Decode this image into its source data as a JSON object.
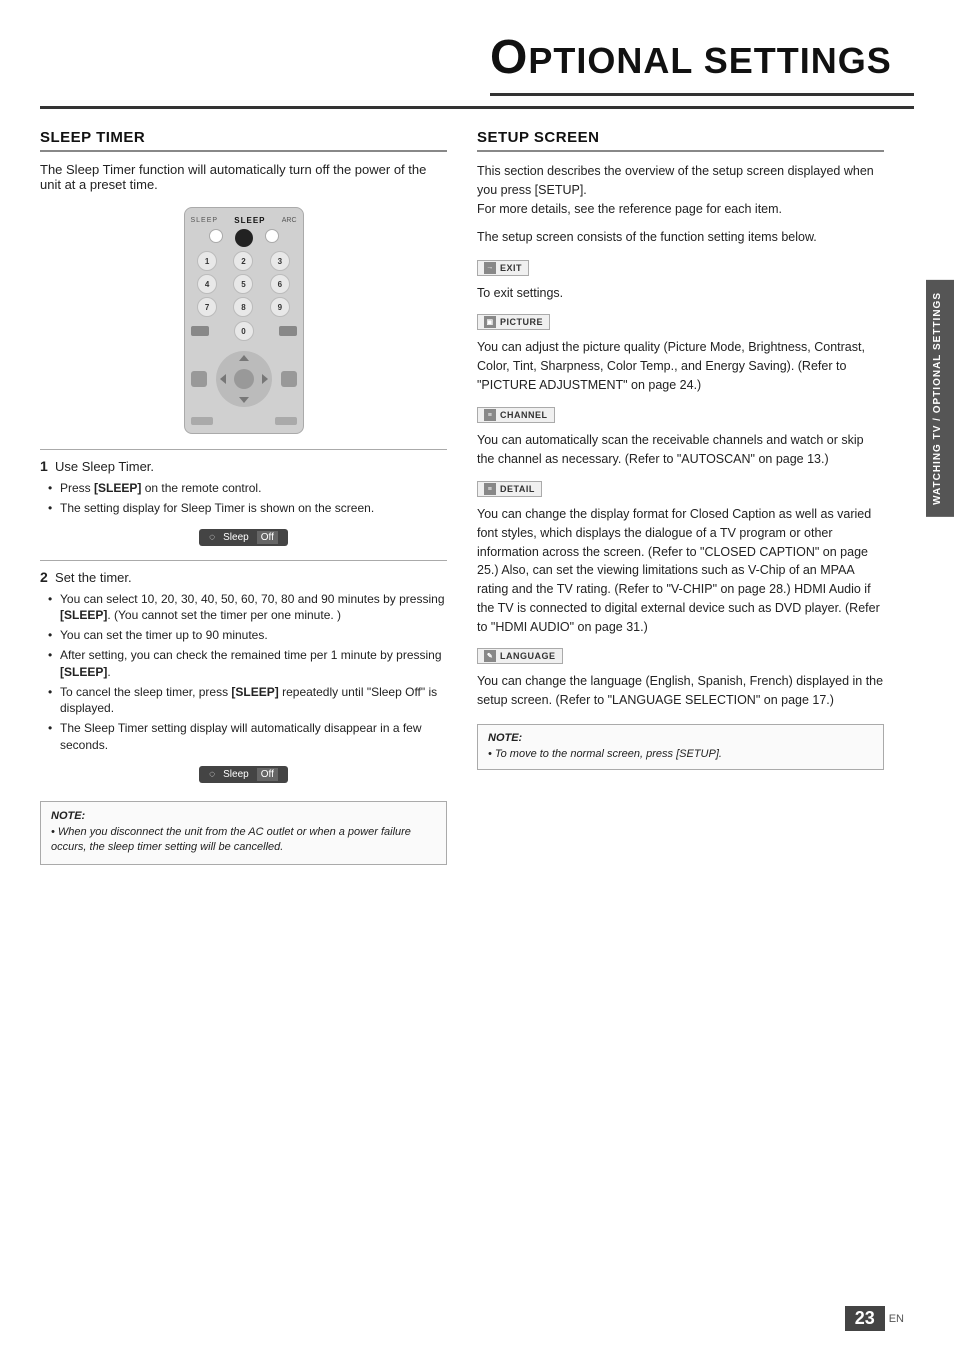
{
  "page": {
    "number": "23",
    "lang": "EN"
  },
  "side_tab": {
    "label": "WATCHING TV / OPTIONAL SETTINGS"
  },
  "header": {
    "title_prefix": "O",
    "title_rest": "PTIONAL SETTINGS"
  },
  "sleep_timer": {
    "section_title": "SLEEP TIMER",
    "intro": "The Sleep Timer function will automatically turn off the power of the unit at a preset time.",
    "remote": {
      "sleep_label": "SLEEP",
      "numbers": [
        "1",
        "2",
        "3",
        "4",
        "5",
        "6",
        "7",
        "8",
        "9",
        "0"
      ]
    },
    "step1": {
      "number": "1",
      "intro": "Use Sleep Timer.",
      "bullets": [
        "Press [SLEEP] on the remote control.",
        "The setting display for Sleep Timer is shown on the screen."
      ]
    },
    "step2": {
      "number": "2",
      "intro": "Set the timer.",
      "bullets": [
        "You can select 10, 20, 30, 40, 50, 60, 70, 80 and 90 minutes by pressing [SLEEP]. (You cannot set the timer per one minute. )",
        "You can set the timer up to 90 minutes.",
        "After setting, you can check the remained time per 1 minute by pressing [SLEEP].",
        "To cancel the sleep timer, press [SLEEP] repeatedly until \"Sleep Off\" is displayed.",
        "The Sleep Timer setting display will automatically disappear in a few seconds."
      ]
    },
    "sleep_display_label": "Sleep",
    "sleep_display_off": "Off",
    "note": {
      "title": "NOTE:",
      "text": "• When you disconnect the unit from the AC outlet or when a power failure occurs, the sleep timer setting will be cancelled."
    }
  },
  "setup_screen": {
    "section_title": "SETUP SCREEN",
    "intro1": "This section describes the overview of the setup screen displayed when you press [SETUP].",
    "intro2": "For more details, see the reference page for each item.",
    "intro3": "The setup screen consists of the function setting items below.",
    "items": [
      {
        "badge": "EXIT",
        "badge_icon": "→",
        "description": "To exit settings."
      },
      {
        "badge": "PICTURE",
        "badge_icon": "🖼",
        "description": "You can adjust the picture quality (Picture Mode, Brightness, Contrast, Color, Tint, Sharpness, Color Temp., and Energy Saving). (Refer to \"PICTURE ADJUSTMENT\" on page 24.)"
      },
      {
        "badge": "CHANNEL",
        "badge_icon": "☰",
        "description": "You can automatically scan the receivable channels and watch or skip the channel as necessary. (Refer to \"AUTOSCAN\" on page 13.)"
      },
      {
        "badge": "DETAIL",
        "badge_icon": "☰",
        "description": "You can change the display format for Closed Caption as well as varied font styles, which displays the dialogue of a TV program or other information across the screen. (Refer to \"CLOSED CAPTION\" on page 25.) Also, can set the viewing limitations such as V-Chip of an MPAA rating and the TV rating. (Refer to \"V-CHIP\" on page 28.) HDMI Audio if the TV is connected to digital external device such as DVD player. (Refer to \"HDMI AUDIO\" on page 31.)"
      },
      {
        "badge": "LANGUAGE",
        "badge_icon": "✎",
        "description": "You can change the language (English, Spanish, French) displayed in the setup screen. (Refer to \"LANGUAGE SELECTION\" on page 17.)"
      }
    ],
    "note": {
      "title": "NOTE:",
      "text": "• To move to the normal screen, press [SETUP]."
    }
  }
}
